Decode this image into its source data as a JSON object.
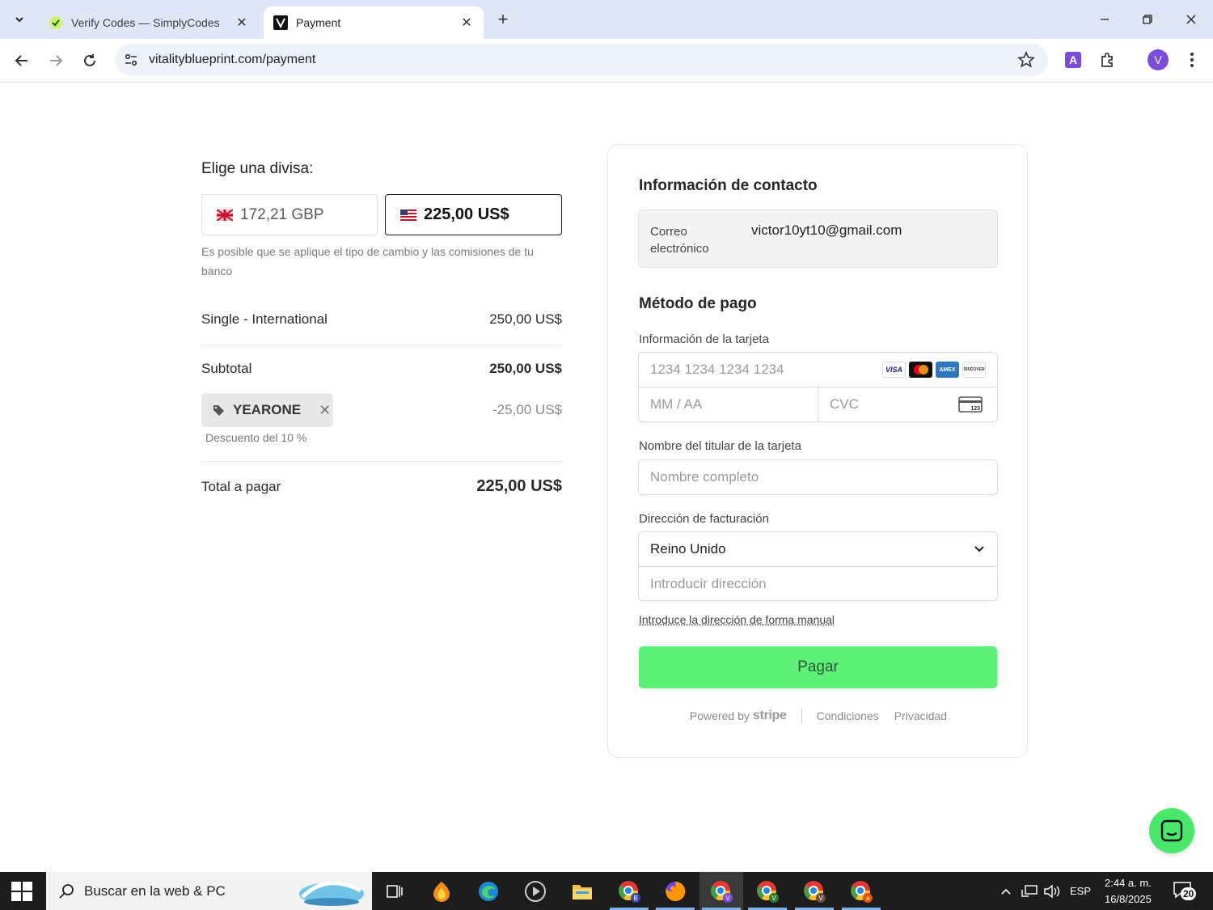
{
  "browser": {
    "tabs": [
      {
        "title": "Verify Codes — SimplyCodes",
        "close": "✕"
      },
      {
        "title": "Payment",
        "close": "✕"
      }
    ],
    "new_tab": "+",
    "url": "vitalityblueprint.com/payment",
    "profile_initial": "V",
    "ext_letter": "A"
  },
  "summary": {
    "currency_title": "Elige una divisa:",
    "currency_options": [
      {
        "label": "172,21 GBP"
      },
      {
        "label": "225,00 US$"
      }
    ],
    "exchange_note": "Es posible que se aplique el tipo de cambio y las comisiones de tu banco",
    "item": {
      "name": "Single - International",
      "price": "250,00 US$"
    },
    "subtotal": {
      "label": "Subtotal",
      "value": "250,00 US$"
    },
    "promo": {
      "code": "YEARONE",
      "remove": "✕",
      "note": "Descuento del 10 %",
      "amount": "-25,00 US$"
    },
    "total": {
      "label": "Total a pagar",
      "value": "225,00 US$"
    }
  },
  "checkout": {
    "contact_title": "Información de contacto",
    "email_label": "Correo electrónico",
    "email_value": "victor10yt10@gmail.com",
    "payment_title": "Método de pago",
    "card_label": "Información de la tarjeta",
    "card_number_placeholder": "1234 1234 1234 1234",
    "expiry_placeholder": "MM / AA",
    "cvc_placeholder": "CVC",
    "card_brands": [
      "VISA",
      "mastercard",
      "AMEX",
      "DISCOVER"
    ],
    "cardholder_label": "Nombre del titular de la tarjeta",
    "cardholder_placeholder": "Nombre completo",
    "billing_label": "Dirección de facturación",
    "country_value": "Reino Unido",
    "address_placeholder": "Introducir dirección",
    "manual_link": "Introduce la dirección de forma manual",
    "pay_label": "Pagar",
    "powered_by": "Powered by",
    "stripe": "stripe",
    "terms": "Condiciones",
    "privacy": "Privacidad",
    "pay_button_color": "#5ff07a"
  },
  "taskbar": {
    "search_text": "Buscar en la web & PC",
    "language": "ESP",
    "time": "2:44 a. m.",
    "date": "16/8/2025",
    "notifications": "20",
    "app_badges": [
      "B",
      "V",
      "V",
      "V",
      "a"
    ]
  }
}
